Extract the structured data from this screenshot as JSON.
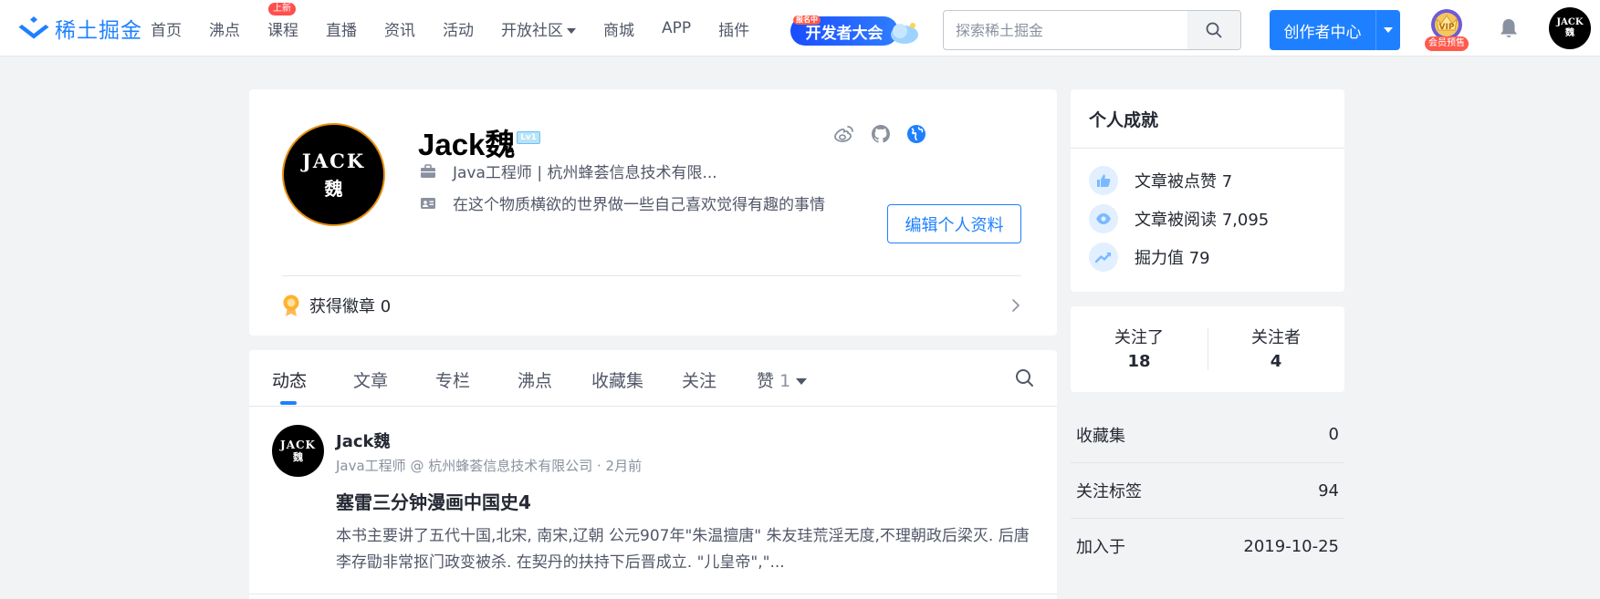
{
  "header": {
    "logo_text": "稀土掘金",
    "nav": [
      {
        "label": "首页"
      },
      {
        "label": "沸点"
      },
      {
        "label": "课程",
        "badge": "上新"
      },
      {
        "label": "直播"
      },
      {
        "label": "资讯"
      },
      {
        "label": "活动"
      },
      {
        "label": "开放社区",
        "dropdown": true
      },
      {
        "label": "商城"
      },
      {
        "label": "APP"
      },
      {
        "label": "插件"
      }
    ],
    "dev_banner": {
      "tag": "报名中",
      "label": "开发者大会"
    },
    "search": {
      "placeholder": "探索稀土掘金"
    },
    "creator_button": "创作者中心",
    "vip_tag": "会员预售",
    "avatar_text": {
      "line1": "JACK",
      "line2": "魏"
    }
  },
  "profile": {
    "avatar_text": {
      "line1": "JACK",
      "line2": "魏"
    },
    "name": "Jack魏",
    "level": "Lv1",
    "job": "Java工程师 | 杭州蜂荟信息技术有限...",
    "bio": "在这个物质横欲的世界做一些自己喜欢觉得有趣的事情",
    "edit_button": "编辑个人资料",
    "badges_label": "获得徽章 0",
    "social_icons": [
      "weibo-icon",
      "github-icon",
      "website-icon"
    ]
  },
  "tabs": {
    "items": [
      {
        "label": "动态",
        "active": true
      },
      {
        "label": "文章"
      },
      {
        "label": "专栏"
      },
      {
        "label": "沸点"
      },
      {
        "label": "收藏集"
      },
      {
        "label": "关注"
      },
      {
        "label": "赞",
        "count": "1",
        "dropdown": true
      }
    ]
  },
  "feed": {
    "author": "Jack魏",
    "meta": "Java工程师 @ 杭州蜂荟信息技术有限公司 · 2月前",
    "title": "塞雷三分钟漫画中国史4",
    "excerpt": "本书主要讲了五代十国,北宋, 南宋,辽朝 公元907年\"朱温擅唐\" 朱友珪荒淫无度,不理朝政后梁灭. 后唐李存勖非常抠门政变被杀. 在契丹的扶持下后晋成立. \"儿皇帝\",\"..."
  },
  "achievements": {
    "title": "个人成就",
    "items": [
      {
        "icon": "thumbs-up-icon",
        "label": "文章被点赞 7"
      },
      {
        "icon": "eye-icon",
        "label": "文章被阅读 7,095"
      },
      {
        "icon": "trend-icon",
        "label": "掘力值 79"
      }
    ]
  },
  "follow": {
    "following_label": "关注了",
    "following_value": "18",
    "followers_label": "关注者",
    "followers_value": "4"
  },
  "stats": [
    {
      "label": "收藏集",
      "value": "0"
    },
    {
      "label": "关注标签",
      "value": "94"
    },
    {
      "label": "加入于",
      "value": "2019-10-25"
    }
  ],
  "colors": {
    "brand": "#1e80ff",
    "badge_red": "#ff4e4e",
    "avatar_ring": "#e5900f"
  }
}
